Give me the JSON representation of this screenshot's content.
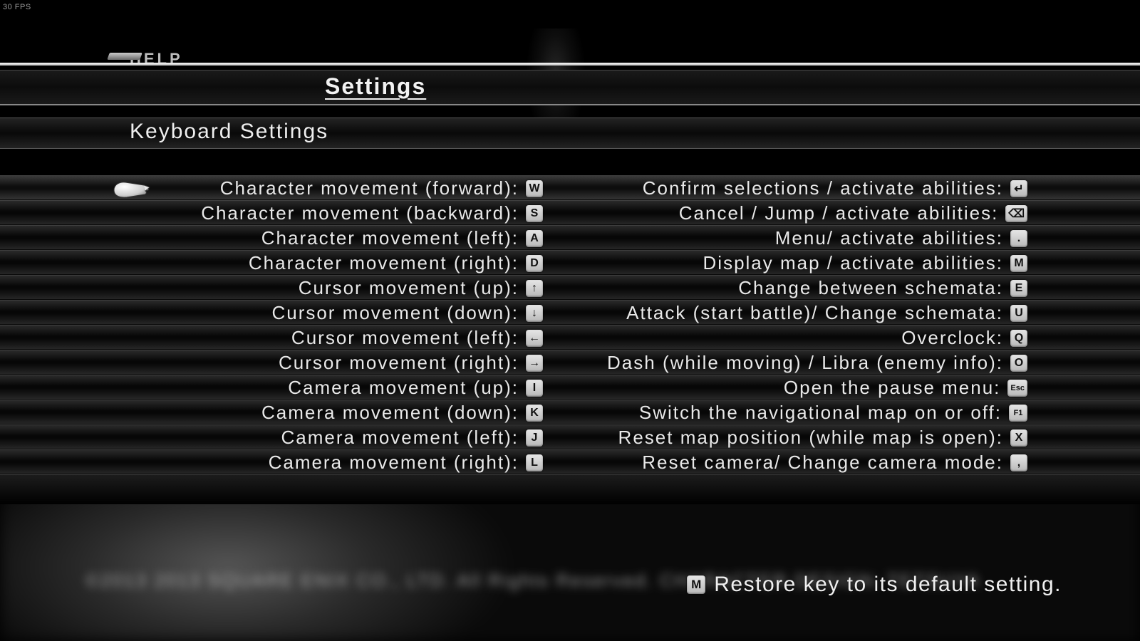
{
  "fps_overlay": "30 FPS",
  "help_label": "HELP",
  "page_title": "Settings",
  "section_title": "Keyboard Settings",
  "selected_row_index": 0,
  "left_bindings": [
    {
      "label": "Character movement (forward):",
      "key": "W"
    },
    {
      "label": "Character movement (backward):",
      "key": "S"
    },
    {
      "label": "Character movement (left):",
      "key": "A"
    },
    {
      "label": "Character movement (right):",
      "key": "D"
    },
    {
      "label": "Cursor movement (up):",
      "key": "↑"
    },
    {
      "label": "Cursor movement (down):",
      "key": "↓"
    },
    {
      "label": "Cursor movement (left):",
      "key": "←"
    },
    {
      "label": "Cursor movement (right):",
      "key": "→"
    },
    {
      "label": "Camera movement (up):",
      "key": "I"
    },
    {
      "label": "Camera movement (down):",
      "key": "K"
    },
    {
      "label": "Camera movement (left):",
      "key": "J"
    },
    {
      "label": "Camera movement (right):",
      "key": "L"
    }
  ],
  "right_bindings": [
    {
      "label": "Confirm selections / activate abilities:",
      "key": "↵"
    },
    {
      "label": "Cancel / Jump / activate abilities:",
      "key": "⌫"
    },
    {
      "label": "Menu/ activate abilities:",
      "key": "."
    },
    {
      "label": "Display map / activate abilities:",
      "key": "M"
    },
    {
      "label": "Change between schemata:",
      "key": "E"
    },
    {
      "label": "Attack (start battle)/ Change schemata:",
      "key": "U"
    },
    {
      "label": "Overclock:",
      "key": "Q"
    },
    {
      "label": "Dash (while moving) / Libra (enemy info):",
      "key": "O"
    },
    {
      "label": "Open the pause menu:",
      "key": "Esc",
      "small": true
    },
    {
      "label": "Switch the navigational map on or off:",
      "key": "F1",
      "small": true
    },
    {
      "label": "Reset map position (while map is open):",
      "key": "X"
    },
    {
      "label": "Reset camera/ Change camera mode:",
      "key": ","
    }
  ],
  "footer_hint": {
    "key": "M",
    "text": "Restore key to its default setting."
  },
  "copyright_blur": "©2013   2013 SQUARE ENIX CO., LTD.   All Rights Reserved.   CHARACTER DESIGN: TETSUYA"
}
